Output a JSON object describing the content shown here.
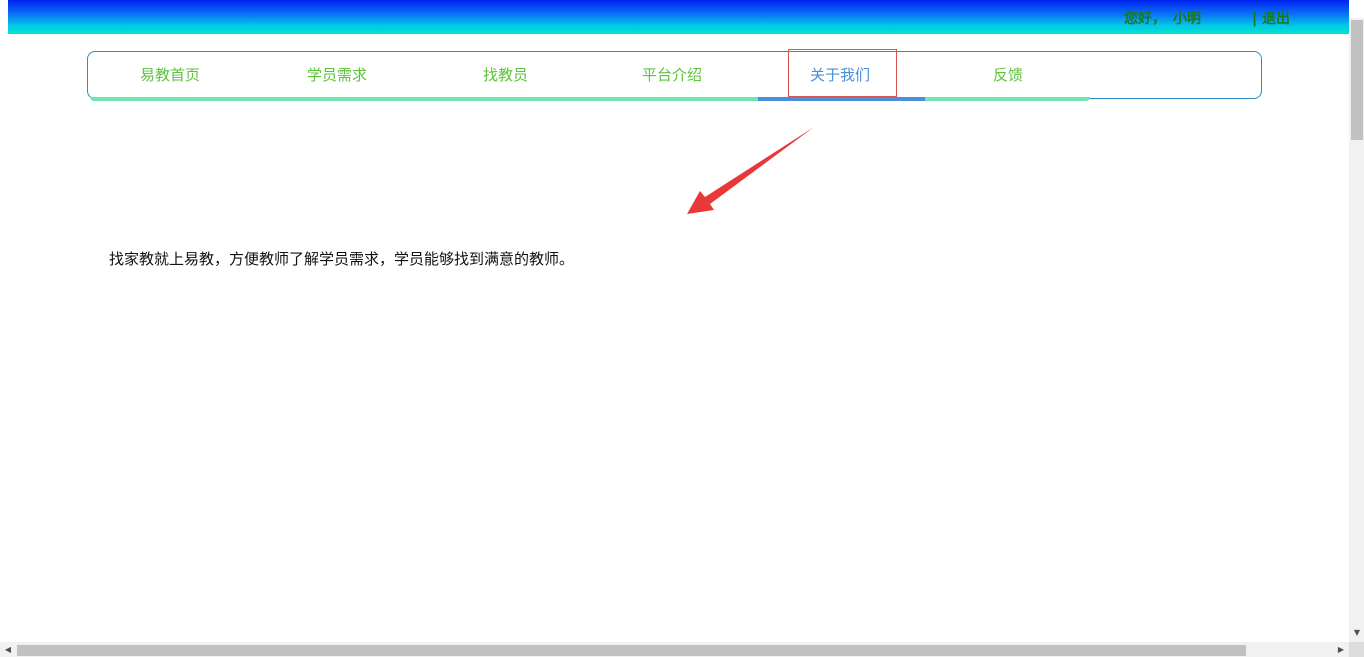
{
  "header": {
    "greeting": "您好，",
    "username": "小明",
    "logout_label": "| 退出",
    "gradient_colors": [
      "#0022f0",
      "#00e6cf"
    ],
    "text_color": "#1a7a1a"
  },
  "nav": {
    "items": [
      {
        "label": "易教首页",
        "active": false
      },
      {
        "label": "学员需求",
        "active": false
      },
      {
        "label": "找教员",
        "active": false
      },
      {
        "label": "平台介绍",
        "active": false
      },
      {
        "label": "关于我们",
        "active": true
      },
      {
        "label": "反馈",
        "active": false
      }
    ],
    "item_color": "#5cc43a",
    "active_color": "#4a8fd8",
    "border_color": "#2a8fc7",
    "underline_color": "#6ee6b4"
  },
  "annotation": {
    "arrow_color": "#e8383a",
    "highlight_box_color": "#d9534f"
  },
  "main": {
    "intro_text": "找家教就上易教，方便教师了解学员需求，学员能够找到满意的教师。"
  },
  "scrollbars": {
    "vertical_down_arrow": "▼",
    "horizontal_left_arrow": "◀",
    "horizontal_right_arrow": "▶"
  }
}
